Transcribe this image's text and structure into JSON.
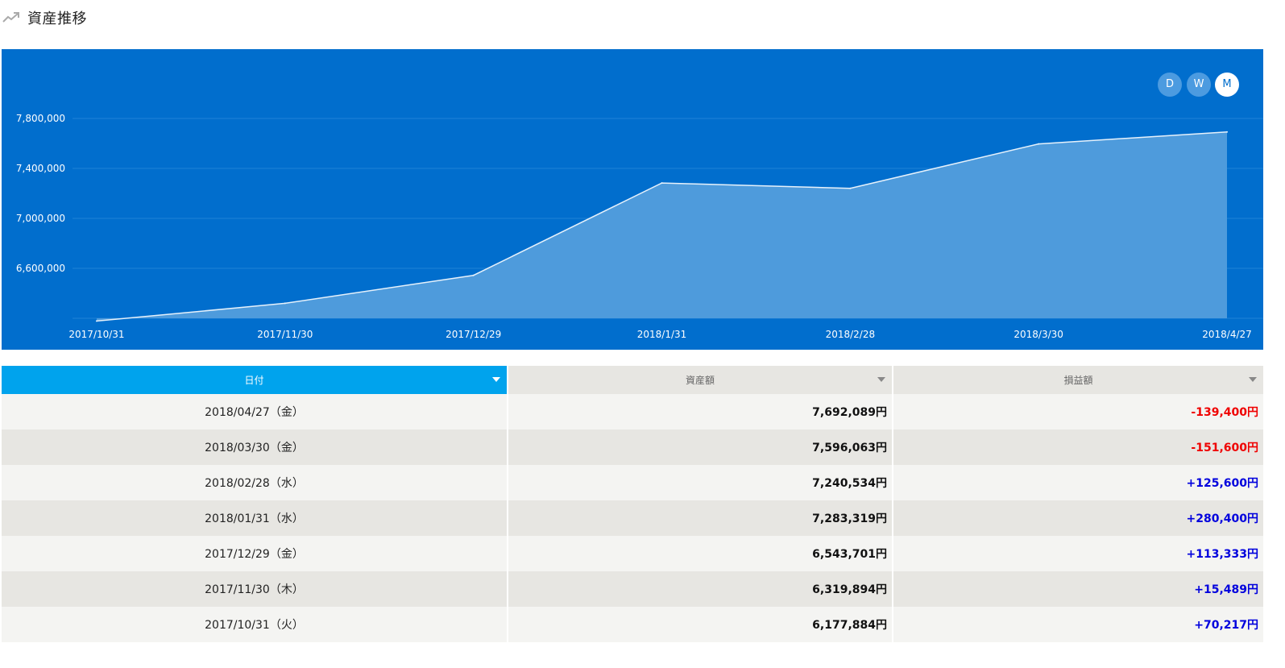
{
  "header": {
    "title": "資産推移",
    "icon": "trend-up-icon"
  },
  "range_buttons": [
    {
      "label": "D",
      "active": false
    },
    {
      "label": "W",
      "active": false
    },
    {
      "label": "M",
      "active": true
    }
  ],
  "colors": {
    "chart_bg": "#016ecd",
    "area_fill": "#4e9bdc",
    "sorted_header": "#00a3ed",
    "negative": "#ef0000",
    "positive": "#0000dd"
  },
  "chart_data": {
    "type": "area",
    "x": [
      "2017/10/31",
      "2017/11/30",
      "2017/12/29",
      "2018/1/31",
      "2018/2/28",
      "2018/3/30",
      "2018/4/27"
    ],
    "series": [
      {
        "values": [
          6177884,
          6319894,
          6543701,
          7283319,
          7240534,
          7596063,
          7692089
        ]
      }
    ],
    "y_ticks": [
      "6,600,000",
      "7,000,000",
      "7,400,000",
      "7,800,000"
    ],
    "y_tick_values": [
      6600000,
      7000000,
      7400000,
      7800000
    ],
    "ylim": [
      6200000,
      7800000
    ],
    "grid": true
  },
  "table": {
    "columns": [
      {
        "label": "日付",
        "sorted": true
      },
      {
        "label": "資産額",
        "sorted": false
      },
      {
        "label": "損益額",
        "sorted": false
      }
    ],
    "rows": [
      {
        "date": "2018/04/27（金）",
        "amount": "7,692,089円",
        "pl": "-139,400円",
        "pl_sign": "neg"
      },
      {
        "date": "2018/03/30（金）",
        "amount": "7,596,063円",
        "pl": "-151,600円",
        "pl_sign": "neg"
      },
      {
        "date": "2018/02/28（水）",
        "amount": "7,240,534円",
        "pl": "+125,600円",
        "pl_sign": "pos"
      },
      {
        "date": "2018/01/31（水）",
        "amount": "7,283,319円",
        "pl": "+280,400円",
        "pl_sign": "pos"
      },
      {
        "date": "2017/12/29（金）",
        "amount": "6,543,701円",
        "pl": "+113,333円",
        "pl_sign": "pos"
      },
      {
        "date": "2017/11/30（木）",
        "amount": "6,319,894円",
        "pl": "+15,489円",
        "pl_sign": "pos"
      },
      {
        "date": "2017/10/31（火）",
        "amount": "6,177,884円",
        "pl": "+70,217円",
        "pl_sign": "pos"
      }
    ]
  }
}
